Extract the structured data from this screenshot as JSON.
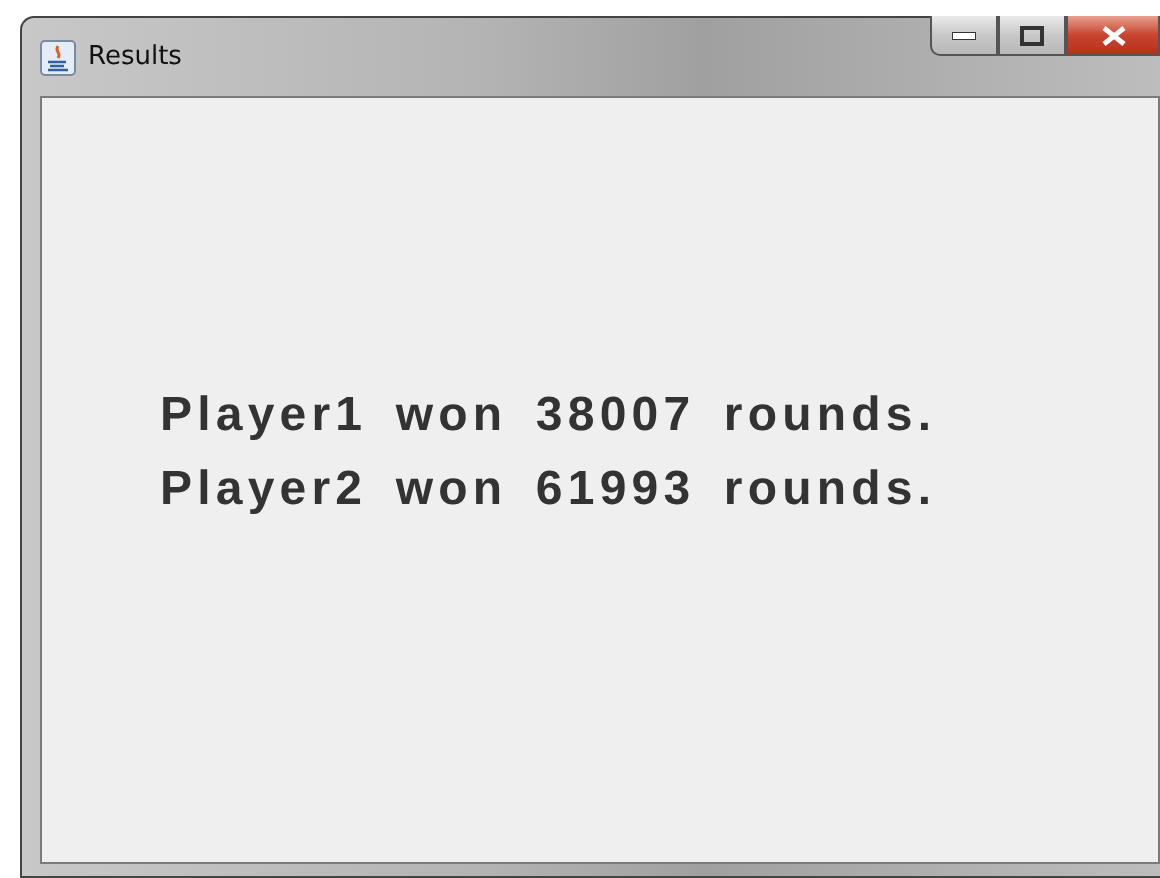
{
  "window": {
    "title": "Results"
  },
  "lines": [
    "Player1 won 38007 rounds.",
    "Player2 won 61993 rounds."
  ]
}
